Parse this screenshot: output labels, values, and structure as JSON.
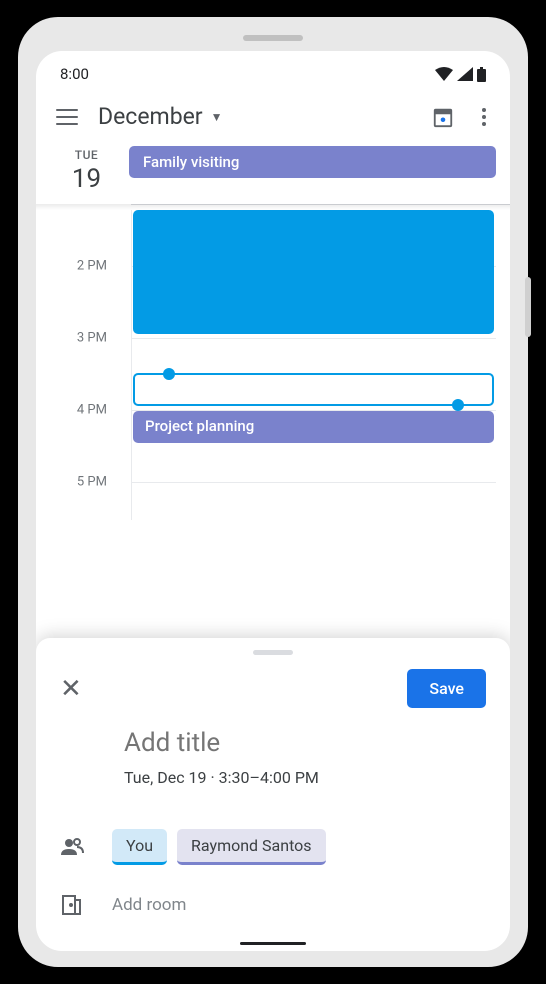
{
  "status": {
    "time": "8:00"
  },
  "header": {
    "month": "December"
  },
  "day": {
    "name": "TUE",
    "number": "19"
  },
  "allday": {
    "title": "Family visiting"
  },
  "times": [
    "2 PM",
    "3 PM",
    "4 PM",
    "5 PM"
  ],
  "events": {
    "project": "Project planning"
  },
  "sheet": {
    "save": "Save",
    "title_placeholder": "Add title",
    "datetime": "Tue, Dec 19  ·  3:30–4:00 PM",
    "you": "You",
    "guest": "Raymond Santos",
    "add_room": "Add room"
  }
}
